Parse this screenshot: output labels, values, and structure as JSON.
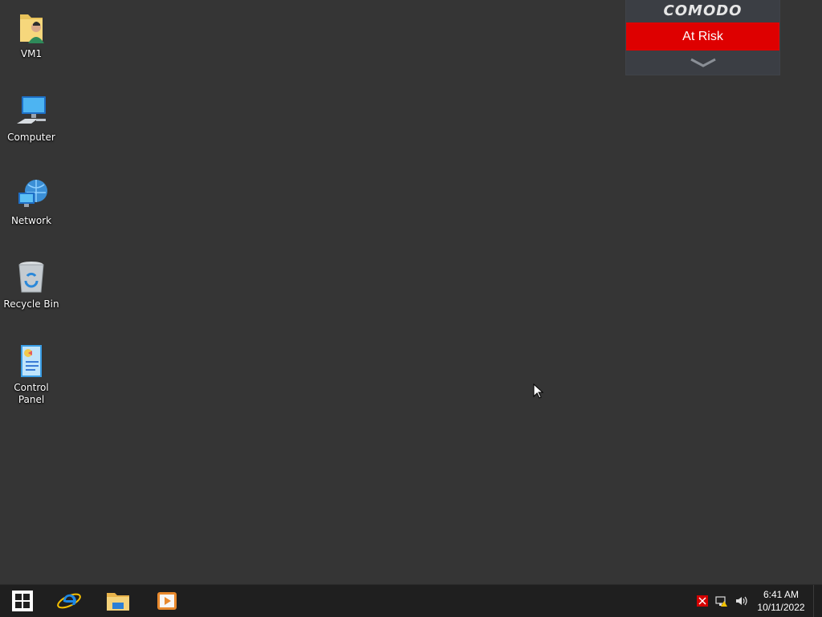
{
  "desktop": {
    "icons": [
      {
        "label": "VM1",
        "icon": "user-folder-icon"
      },
      {
        "label": "Computer",
        "icon": "computer-icon"
      },
      {
        "label": "Network",
        "icon": "network-icon"
      },
      {
        "label": "Recycle Bin",
        "icon": "recycle-bin-icon"
      },
      {
        "label": "Control Panel",
        "icon": "control-panel-icon"
      }
    ]
  },
  "comodo": {
    "brand": "COMODO",
    "status": "At Risk",
    "status_color": "#de0000"
  },
  "taskbar": {
    "pinned": [
      {
        "name": "internet-explorer",
        "icon": "internet-explorer-icon"
      },
      {
        "name": "file-explorer",
        "icon": "file-explorer-icon"
      },
      {
        "name": "media-player",
        "icon": "media-player-icon"
      }
    ],
    "tray": {
      "icons": [
        "comodo-alert-icon",
        "network-warning-icon",
        "volume-icon"
      ]
    },
    "clock": {
      "time": "6:41 AM",
      "date": "10/11/2022"
    }
  }
}
